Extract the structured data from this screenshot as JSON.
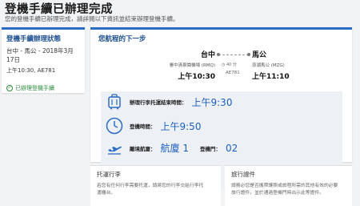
{
  "header": {
    "title": "登機手續已辦理完成",
    "subtitle": "您的登機手續已辦理完成，請詳閱以下資訊並結束辦理登機手續。"
  },
  "summary": {
    "title": "登機手續辦理狀態",
    "route": "台中 - 馬公 - 2018年3月",
    "date_day": "17日",
    "flight_line": "上午10:30, AE781",
    "status": "已辦理登機手續",
    "status_color": "#2e8b3e"
  },
  "next_steps": {
    "title": "您航程的下一步",
    "departure": {
      "city": "台中",
      "airport": "臺中清泉崗機場 (RMQ)",
      "time": "上午10:30"
    },
    "arrival": {
      "city": "馬公",
      "airport": "澎湖馬公 (MZG)",
      "time": "上午11:10"
    },
    "duration": "40 分",
    "flight_number": "AE781"
  },
  "details": {
    "bag_drop_label": "辦理行李托運結束時間：",
    "bag_drop_time": "上午9:30",
    "boarding_label": "登機時間：",
    "boarding_time": "上午9:50",
    "terminal_label": "離境航廈：",
    "terminal_value": "航廈 1",
    "gate_label": "登機門：",
    "gate_value": "02"
  },
  "luggage": {
    "title": "托運行李",
    "text_line1": "若您有任何行李需要托運，請將您的行李交給行李托",
    "text_line2": "運櫃台。"
  },
  "documents": {
    "title": "旅行證件",
    "text_line1": "請務必您是否攜帶護照或旅程所需的其他有效的必要",
    "text_line2": "旅行證件，並於通過登機門時出示此等證件。"
  },
  "colors": {
    "accent": "#2b6cc4",
    "value_blue": "#1d5fbf",
    "info_bg": "#edf1f6"
  },
  "icons": [
    "check-circle-icon",
    "suitcase-icon",
    "clock-icon",
    "plane-takeoff-icon"
  ]
}
